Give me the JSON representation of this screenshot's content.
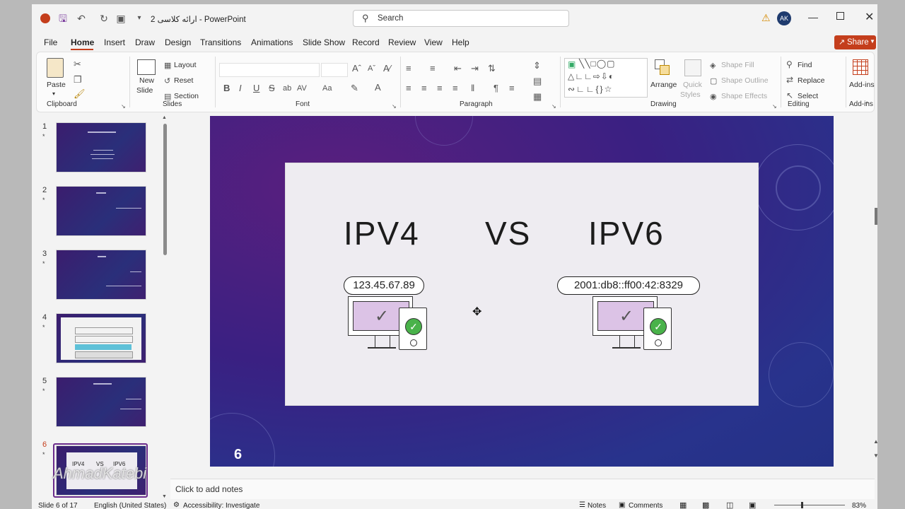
{
  "window": {
    "title": "ارائه کلاسی 2  -  PowerPoint",
    "search_placeholder": "Search",
    "user_initials": "AK",
    "share_label": "Share",
    "warning_icon": "warning-icon"
  },
  "menu": [
    "File",
    "Home",
    "Insert",
    "Draw",
    "Design",
    "Transitions",
    "Animations",
    "Slide Show",
    "Record",
    "Review",
    "View",
    "Help"
  ],
  "ribbon": {
    "clipboard": {
      "paste": "Paste",
      "group": "Clipboard"
    },
    "slides": {
      "new_slide_1": "New",
      "new_slide_2": "Slide",
      "layout": "Layout",
      "reset": "Reset",
      "section": "Section",
      "group": "Slides"
    },
    "font": {
      "bold": "B",
      "italic": "I",
      "underline": "U",
      "strike": "S",
      "spacing": "AV",
      "case": "Aa",
      "group": "Font"
    },
    "paragraph": {
      "group": "Paragraph"
    },
    "drawing": {
      "arrange": "Arrange",
      "quick_styles_1": "Quick",
      "quick_styles_2": "Styles",
      "shape_fill": "Shape Fill",
      "shape_outline": "Shape Outline",
      "shape_effects": "Shape Effects",
      "group": "Drawing"
    },
    "editing": {
      "find": "Find",
      "replace": "Replace",
      "select": "Select",
      "group": "Editing"
    },
    "addins": {
      "label": "Add-ins",
      "group": "Add-ins"
    }
  },
  "thumbnails": [
    {
      "num": "1",
      "star": "*"
    },
    {
      "num": "2",
      "star": "*"
    },
    {
      "num": "3",
      "star": "*"
    },
    {
      "num": "4",
      "star": "*"
    },
    {
      "num": "5",
      "star": "*"
    },
    {
      "num": "6",
      "star": "*"
    }
  ],
  "thumb6_text": {
    "left": "IPV4",
    "mid": "VS",
    "right": "IPV6"
  },
  "watermark": "AhmadKatebi",
  "slide": {
    "left_title": "IPV4",
    "mid_title": "VS",
    "right_title": "IPV6",
    "ipv4_address": "123.45.67.89",
    "ipv6_address": "2001:db8::ff00:42:8329",
    "slide_number": "6"
  },
  "notes_placeholder": "Click to add notes",
  "status": {
    "slide_info": "Slide 6 of 17",
    "language": "English (United States)",
    "accessibility": "Accessibility: Investigate",
    "notes": "Notes",
    "comments": "Comments",
    "zoom": "83%"
  }
}
